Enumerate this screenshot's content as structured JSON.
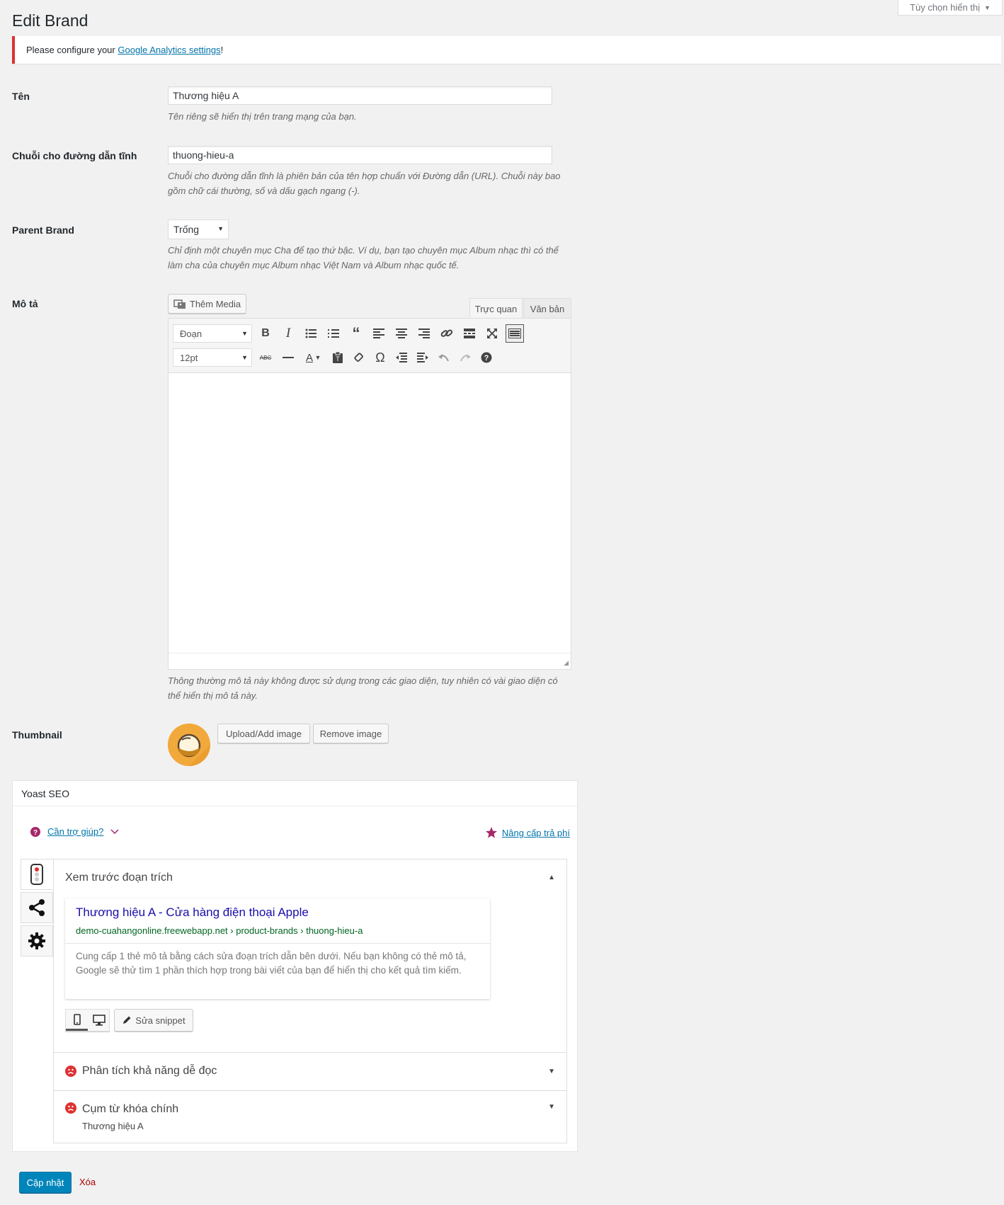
{
  "screen_options": {
    "label": "Tùy chọn hiển thị"
  },
  "page": {
    "title": "Edit Brand"
  },
  "notice": {
    "prefix": "Please configure your ",
    "link": "Google Analytics settings",
    "suffix": "!"
  },
  "fields": {
    "name": {
      "label": "Tên",
      "value": "Thương hiệu A",
      "desc": "Tên riêng sẽ hiển thị trên trang mạng của bạn."
    },
    "slug": {
      "label": "Chuỗi cho đường dẫn tĩnh",
      "value": "thuong-hieu-a",
      "desc": "Chuỗi cho đường dẫn tĩnh là phiên bản của tên hợp chuẩn với Đường dẫn (URL). Chuỗi này bao gồm chữ cái thường, số và dấu gạch ngang (-)."
    },
    "parent": {
      "label": "Parent Brand",
      "value": "Trống",
      "desc": "Chỉ định một chuyên mục Cha để tạo thứ bậc. Ví dụ, bạn tạo chuyên mục Album nhạc thì có thể làm cha của chuyên mục Album nhạc Việt Nam và Album nhạc quốc tế."
    },
    "description": {
      "label": "Mô tả",
      "desc": "Thông thường mô tả này không được sử dụng trong các giao diện, tuy nhiên có vài giao diện có thể hiển thị mô tả này."
    },
    "thumbnail": {
      "label": "Thumbnail",
      "upload_label": "Upload/Add image",
      "remove_label": "Remove image"
    }
  },
  "editor": {
    "add_media": "Thêm Media",
    "tab_visual": "Trực quan",
    "tab_text": "Văn bản",
    "format_select": "Đoạn",
    "size_select": "12pt",
    "strike_label": "ABC",
    "text_color_label": "A"
  },
  "yoast": {
    "title": "Yoast SEO",
    "help_link": "Cần trợ giúp?",
    "upgrade_link": "Nâng cấp trả phí",
    "snippet_heading": "Xem trước đoạn trích",
    "snippet": {
      "title": "Thương hiệu A - Cửa hàng điện thoại Apple",
      "url": "demo-cuahangonline.freewebapp.net › product-brands › thuong-hieu-a",
      "desc": "Cung cấp 1 thẻ mô tả bằng cách sửa đoạn trích dẫn bên dưới. Nếu bạn không có thẻ mô tả, Google sẽ thử tìm 1 phần thích hợp trong bài viết của bạn để hiển thị cho kết quả tìm kiếm."
    },
    "edit_snippet": "Sửa snippet",
    "readability": "Phân tích khả năng dễ đọc",
    "keyphrase": "Cụm từ khóa chính",
    "keyphrase_value": "Thương hiệu A"
  },
  "actions": {
    "update": "Cập nhật",
    "delete": "Xóa"
  },
  "colors": {
    "primary": "#0085ba",
    "notice_border": "#dc3232",
    "link": "#0073aa",
    "yoast_purple": "#a4286a"
  }
}
